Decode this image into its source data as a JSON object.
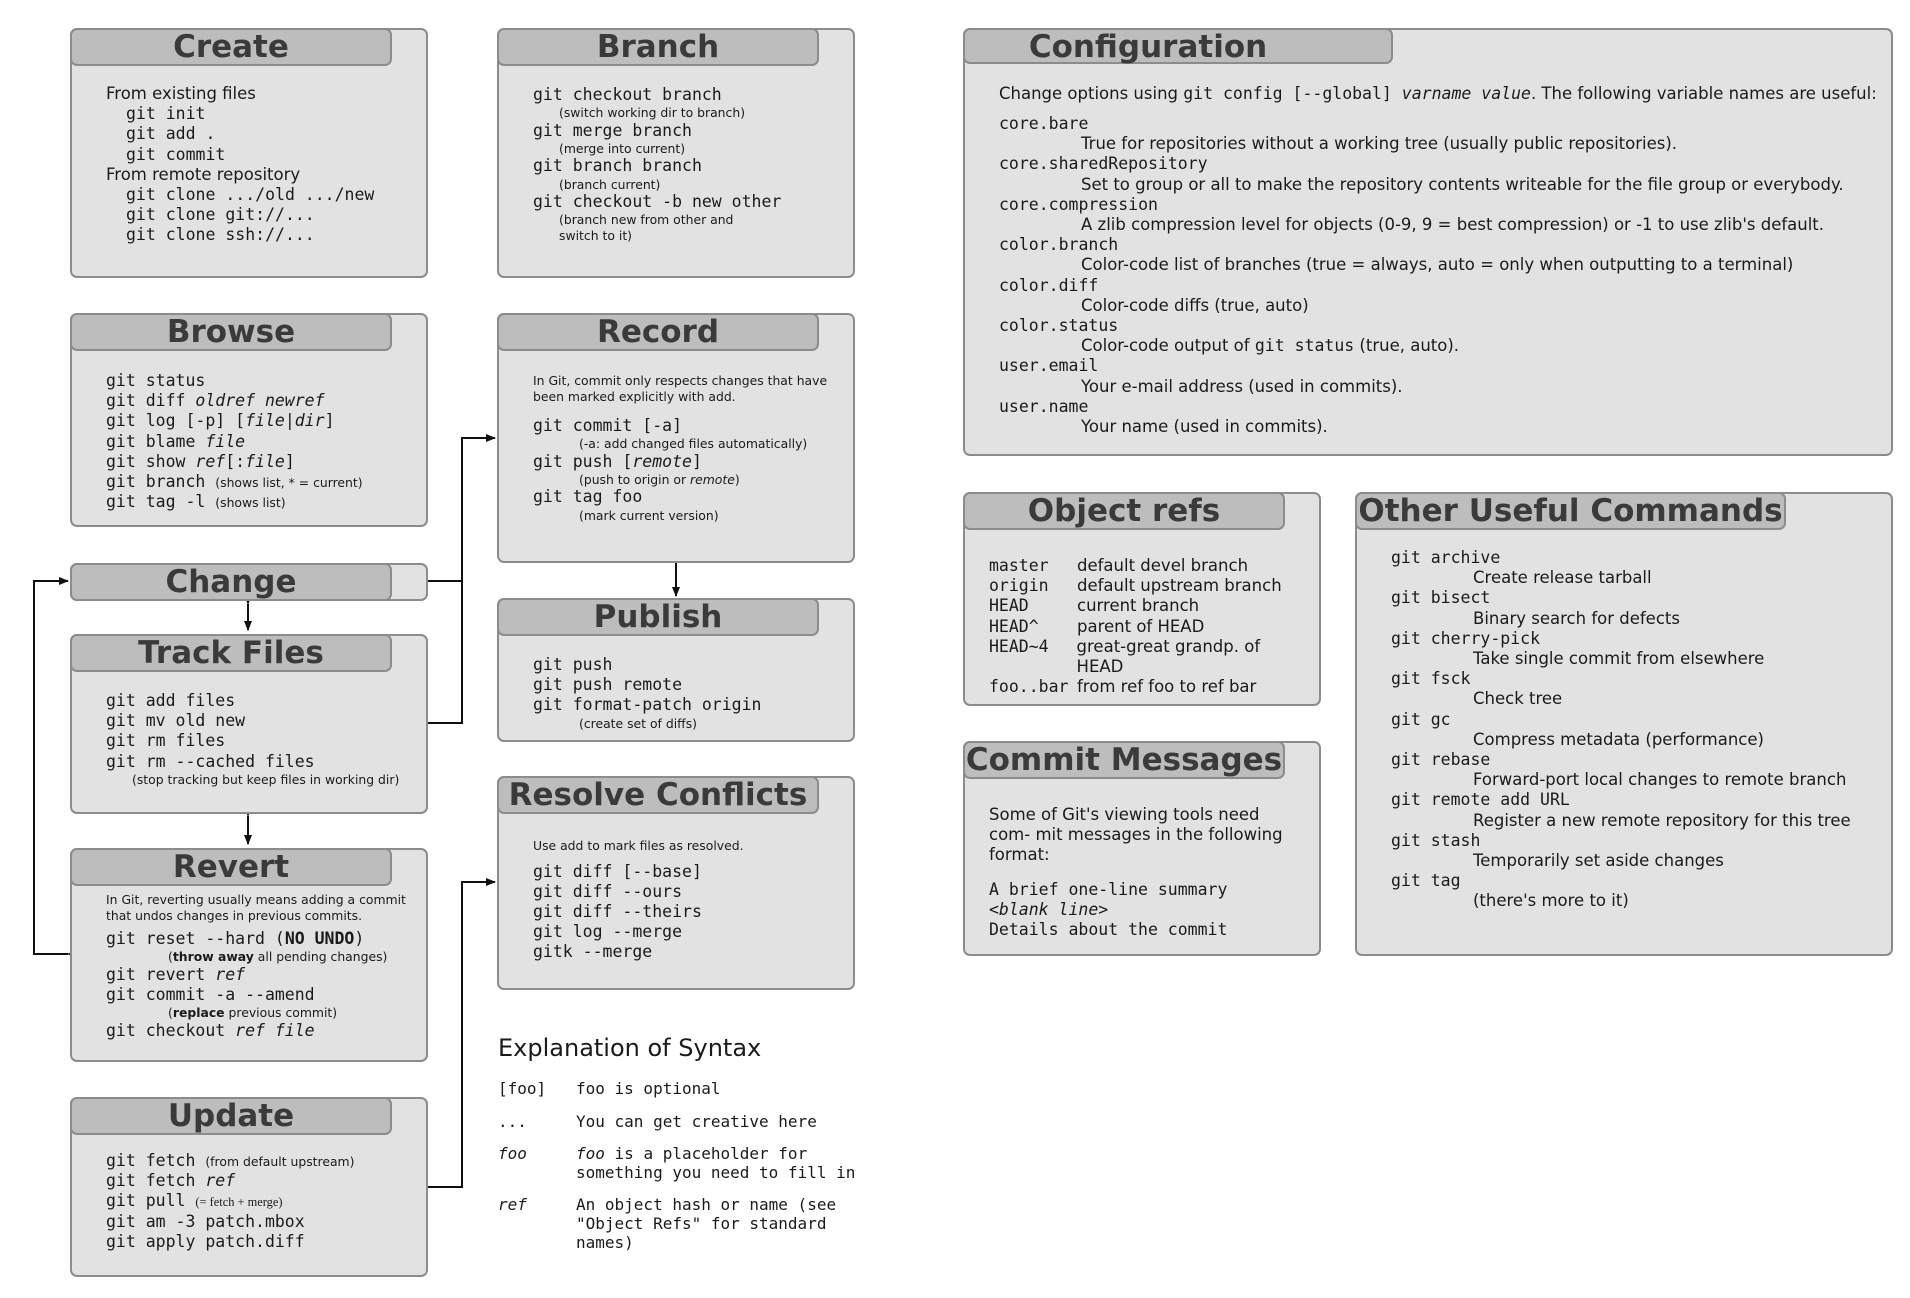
{
  "create": {
    "title": "Create",
    "existing_label": "From existing files",
    "existing_cmds": [
      "git init",
      "git add .",
      "git commit"
    ],
    "remote_label": "From remote repository",
    "remote_cmds": [
      "git clone .../old .../new",
      "git clone git://...",
      "git clone ssh://..."
    ]
  },
  "browse": {
    "title": "Browse",
    "cmd1": "git status",
    "cmd2_pre": "git diff ",
    "cmd2_it": "oldref newref",
    "cmd3_pre": "git log [-p] [",
    "cmd3_it": "file|dir",
    "cmd3_post": "]",
    "cmd4_pre": "git blame ",
    "cmd4_it": "file",
    "cmd5_pre": "git show ",
    "cmd5_it": "ref",
    "cmd5_mid": "[:",
    "cmd5_it2": "file",
    "cmd5_post": "]",
    "cmd6": "git branch",
    "cmd6_note": "(shows list, * = current)",
    "cmd7": "git tag -l",
    "cmd7_note": "(shows list)"
  },
  "change": {
    "title": "Change"
  },
  "track": {
    "title": "Track Files",
    "cmds": [
      "git add files",
      "git mv old new",
      "git rm files",
      "git rm --cached files"
    ],
    "note": "(stop tracking but keep files in working dir)"
  },
  "revert": {
    "title": "Revert",
    "intro": "In Git, reverting usually means adding a commit that undos changes in previous commits.",
    "c1_pre": "git reset --hard (",
    "c1_bold": "NO UNDO",
    "c1_post": ")",
    "c1_note_bold": "throw away",
    "c1_note": " all pending changes)",
    "c2_pre": "git revert ",
    "c2_it": "ref",
    "c3": "git commit -a --amend",
    "c3_note_bold": "replace",
    "c3_note": " previous commit)",
    "c4_pre": "git checkout ",
    "c4_it": "ref file"
  },
  "update": {
    "title": "Update",
    "c1": "git fetch",
    "c1_note": "(from default upstream)",
    "c2_pre": "git fetch ",
    "c2_it": "ref",
    "c3": "git pull",
    "c3_note": "(= fetch + merge)",
    "c4": "git am -3 patch.mbox",
    "c5": "git apply patch.diff"
  },
  "branch": {
    "title": "Branch",
    "items": [
      {
        "cmd": "git checkout branch",
        "note": "(switch working dir to branch)"
      },
      {
        "cmd": "git merge branch",
        "note": "(merge into current)"
      },
      {
        "cmd": "git branch branch",
        "note": "(branch current)"
      },
      {
        "cmd": "git checkout -b new other",
        "note": "(branch new from other and switch to it)"
      }
    ]
  },
  "record": {
    "title": "Record",
    "intro": "In Git, commit only respects changes that have been marked explicitly with add.",
    "c1": "git commit [-a]",
    "c1_note": "(-a: add changed files automatically)",
    "c2_pre": "git push [",
    "c2_it": "remote",
    "c2_post": "]",
    "c2_note_pre": "(push to origin or ",
    "c2_note_it": "remote",
    "c2_note_post": ")",
    "c3": "git tag foo",
    "c3_note": "(mark current version)"
  },
  "publish": {
    "title": "Publish",
    "cmds": [
      "git push",
      "git push remote",
      "git format-patch origin"
    ],
    "note": "(create set of diffs)"
  },
  "resolve": {
    "title": "Resolve Conflicts",
    "intro": "Use add to mark files as resolved.",
    "cmds": [
      "git diff [--base]",
      "git diff --ours",
      "git diff --theirs",
      "git log --merge",
      "gitk --merge"
    ]
  },
  "syntax": {
    "title": "Explanation of Syntax",
    "rows": [
      {
        "key": "[foo]",
        "desc": "foo is optional"
      },
      {
        "key": "...",
        "desc": "You can get creative here"
      },
      {
        "key": "foo",
        "desc_it": "foo",
        "desc": " is a placeholder for something you need to fill in"
      },
      {
        "key": "ref",
        "desc": "An object hash or name (see \"Object Refs\" for standard names)"
      }
    ]
  },
  "config": {
    "title": "Configuration",
    "intro_pre": "Change options using ",
    "intro_code": "git config [--global] ",
    "intro_it": "varname value",
    "intro_post": ". The following variable names are useful:",
    "vars": [
      {
        "name": "core.bare",
        "desc": "True for repositories without a working tree (usually public repositories)."
      },
      {
        "name": "core.sharedRepository",
        "desc": "Set to group or all to make the repository contents writeable for the file group or everybody."
      },
      {
        "name": "core.compression",
        "desc": "A zlib compression level for objects (0-9, 9 = best compression) or -1 to use zlib's default."
      },
      {
        "name": "color.branch",
        "desc": "Color-code list of branches (true = always, auto = only when outputting to a terminal)"
      },
      {
        "name": "color.diff",
        "desc": "Color-code diffs (true, auto)"
      },
      {
        "name": "color.status",
        "desc_pre": "Color-code output of ",
        "desc_code": "git status",
        "desc": " (true, auto)."
      },
      {
        "name": "user.email",
        "desc": "Your e-mail address (used in commits)."
      },
      {
        "name": "user.name",
        "desc": "Your name (used in commits)."
      }
    ]
  },
  "objrefs": {
    "title": "Object refs",
    "rows": [
      {
        "k": "master",
        "v": "default devel branch"
      },
      {
        "k": "origin",
        "v": "default upstream branch"
      },
      {
        "k": "HEAD",
        "v": "current branch"
      },
      {
        "k": "HEAD^",
        "v": "parent of HEAD"
      },
      {
        "k": "HEAD~4",
        "v": "great-great grandp. of HEAD"
      },
      {
        "k": "foo..bar",
        "v": "from ref foo to ref bar"
      }
    ]
  },
  "commitmsg": {
    "title": "Commit Messages",
    "intro": "Some of Git's viewing tools need com- mit messages in the following format:",
    "l1": "A brief one-line summary",
    "l2": "<blank line>",
    "l3": "Details about the commit"
  },
  "other": {
    "title": "Other Useful Commands",
    "items": [
      {
        "cmd": "git archive",
        "desc": "Create release tarball"
      },
      {
        "cmd": "git bisect",
        "desc": "Binary search for defects"
      },
      {
        "cmd": "git cherry-pick",
        "desc": "Take single commit from elsewhere"
      },
      {
        "cmd": "git fsck",
        "desc": "Check tree"
      },
      {
        "cmd": "git gc",
        "desc": "Compress metadata (performance)"
      },
      {
        "cmd": "git rebase",
        "desc": "Forward-port local changes to remote branch"
      },
      {
        "cmd": "git remote add URL",
        "desc": "Register a new remote repository for this tree"
      },
      {
        "cmd": "git stash",
        "desc": "Temporarily set aside changes"
      },
      {
        "cmd": "git tag",
        "desc": "(there's more to it)"
      }
    ]
  }
}
